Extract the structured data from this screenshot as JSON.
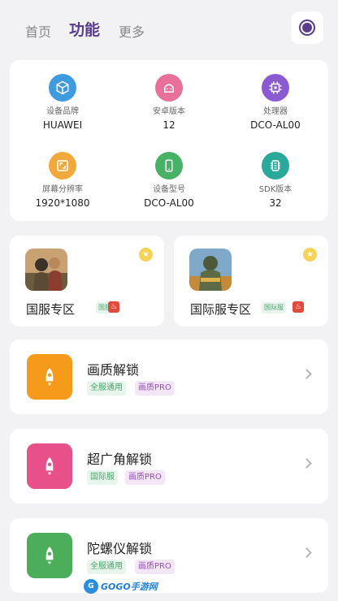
{
  "tabs": [
    {
      "label": "首页",
      "active": false
    },
    {
      "label": "功能",
      "active": true
    },
    {
      "label": "更多",
      "active": false
    }
  ],
  "theme_button": {
    "icon": "theme-toggle-icon",
    "color": "#5a3d8c"
  },
  "device_info": [
    {
      "label": "设备品牌",
      "value": "HUAWEI",
      "icon": "cube-icon",
      "color": "#3f9be0"
    },
    {
      "label": "安卓版本",
      "value": "12",
      "icon": "android-icon",
      "color": "#e8709a"
    },
    {
      "label": "处理器",
      "value": "DCO-AL00",
      "icon": "chip-icon",
      "color": "#8a5bd0"
    },
    {
      "label": "屏幕分辨率",
      "value": "1920*1080",
      "icon": "screen-icon",
      "color": "#f2a93b"
    },
    {
      "label": "设备型号",
      "value": "DCO-AL00",
      "icon": "phone-icon",
      "color": "#47b266"
    },
    {
      "label": "SDK版本",
      "value": "32",
      "icon": "sdk-icon",
      "color": "#2aa89a"
    }
  ],
  "games": [
    {
      "title": "国服专区",
      "tag": "国服",
      "star_icon": "star-icon",
      "fire_icon": "fire-icon"
    },
    {
      "title": "国际服专区",
      "tag": "国际服",
      "star_icon": "star-icon",
      "fire_icon": "fire-icon"
    }
  ],
  "features": [
    {
      "title": "画质解锁",
      "chips": [
        "全服通用",
        "画质PRO"
      ],
      "icon": "rocket-icon",
      "color": "#f59a1b"
    },
    {
      "title": "超广角解锁",
      "chips": [
        "国际服",
        "画质PRO"
      ],
      "icon": "rocket-icon",
      "color": "#e8508a"
    },
    {
      "title": "陀螺仪解锁",
      "chips": [
        "全服通用",
        "画质PRO"
      ],
      "icon": "rocket-icon",
      "color": "#4cae5a"
    }
  ],
  "watermark": {
    "badge": "G",
    "text": "GOGO手游网"
  }
}
